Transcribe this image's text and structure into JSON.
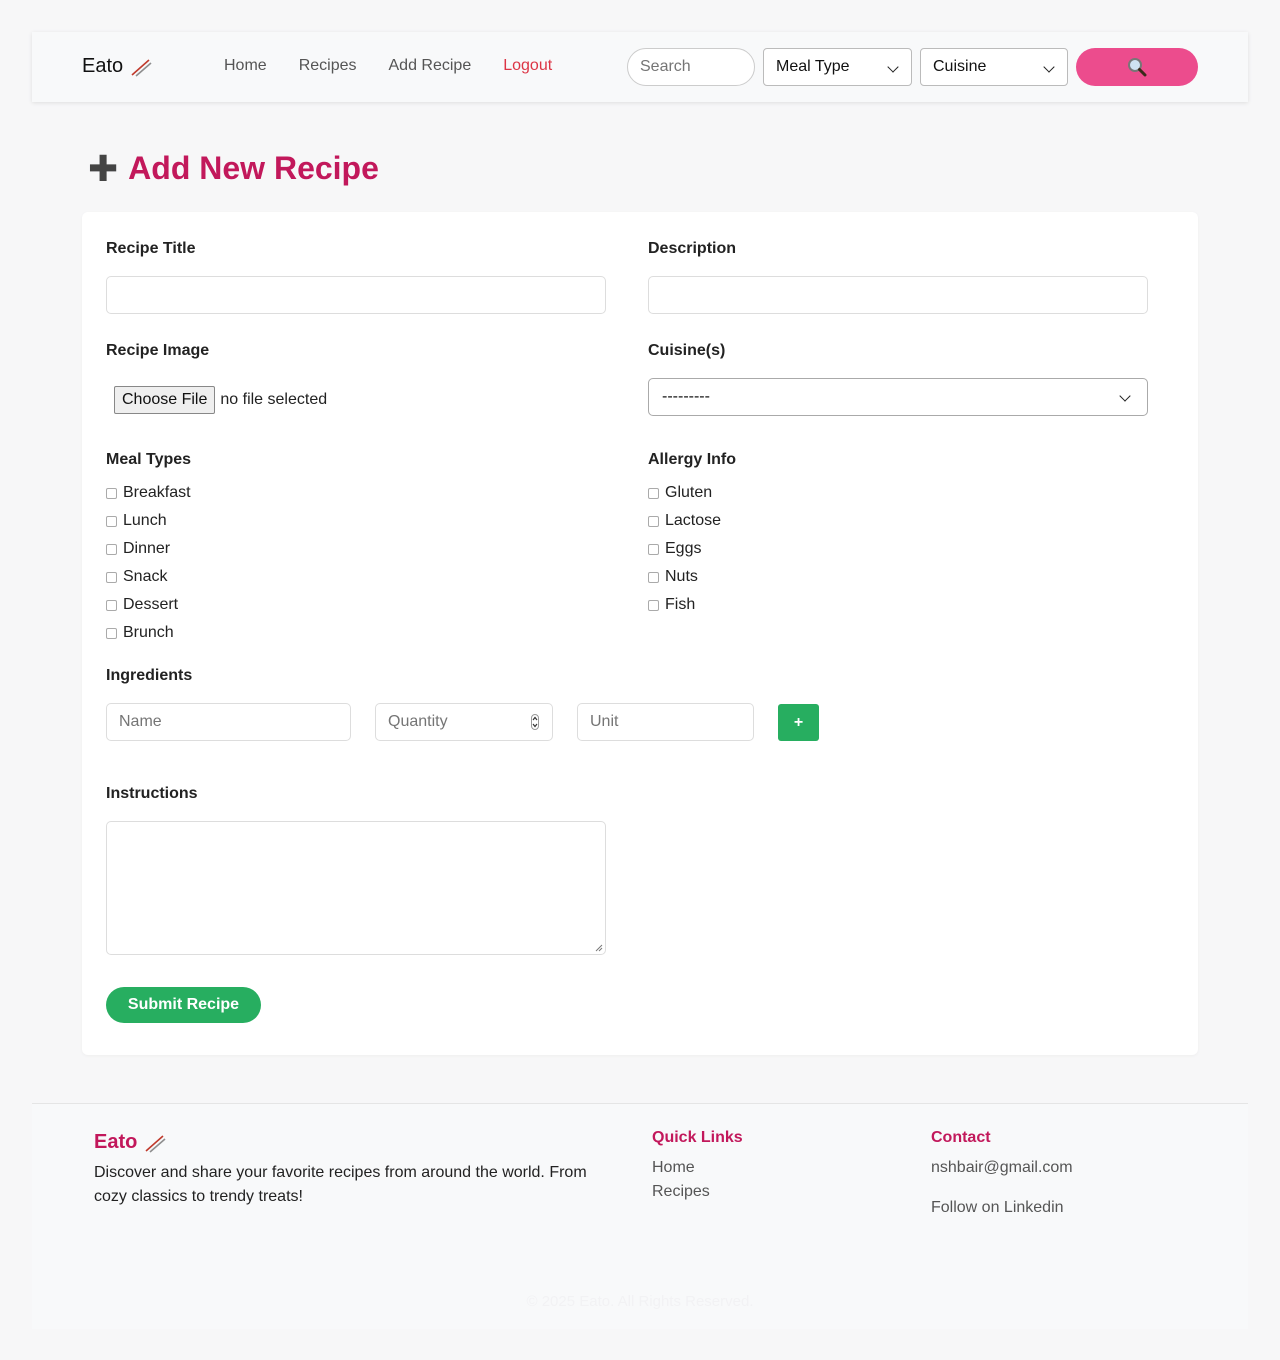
{
  "nav": {
    "brand": "Eato",
    "links": [
      "Home",
      "Recipes",
      "Add Recipe",
      "Logout"
    ],
    "search_placeholder": "Search",
    "meal_type_selected": "Meal Type",
    "cuisine_selected": "Cuisine",
    "search_icon": "magnifier-icon"
  },
  "page": {
    "title": "Add New Recipe"
  },
  "form": {
    "recipe_title_label": "Recipe Title",
    "recipe_title_value": "",
    "description_label": "Description",
    "description_value": "",
    "recipe_image_label": "Recipe Image",
    "choose_file_label": "Choose File",
    "file_status": "no file selected",
    "cuisines_label": "Cuisine(s)",
    "cuisines_selected": "---------",
    "meal_types_label": "Meal Types",
    "meal_types": [
      "Breakfast",
      "Lunch",
      "Dinner",
      "Snack",
      "Dessert",
      "Brunch"
    ],
    "allergy_label": "Allergy Info",
    "allergies": [
      "Gluten",
      "Lactose",
      "Eggs",
      "Nuts",
      "Fish"
    ],
    "ingredients_label": "Ingredients",
    "ingredient_name_placeholder": "Name",
    "ingredient_quantity_placeholder": "Quantity",
    "ingredient_unit_placeholder": "Unit",
    "add_ingredient_label": "+",
    "instructions_label": "Instructions",
    "submit_label": "Submit Recipe"
  },
  "footer": {
    "brand": "Eato",
    "description": "Discover and share your favorite recipes from around the world. From cozy classics to trendy treats!",
    "quick_links_heading": "Quick Links",
    "quick_links": [
      "Home",
      "Recipes"
    ],
    "contact_heading": "Contact",
    "email": "nshbair@gmail.com",
    "follow": "Follow on Linkedin",
    "copyright": "© 2025 Eato. All Rights Reserved."
  },
  "colors": {
    "brand_pink": "#c2185b",
    "search_button": "#ec4c8d",
    "green": "#27ae60",
    "logout_red": "#dc3545"
  }
}
